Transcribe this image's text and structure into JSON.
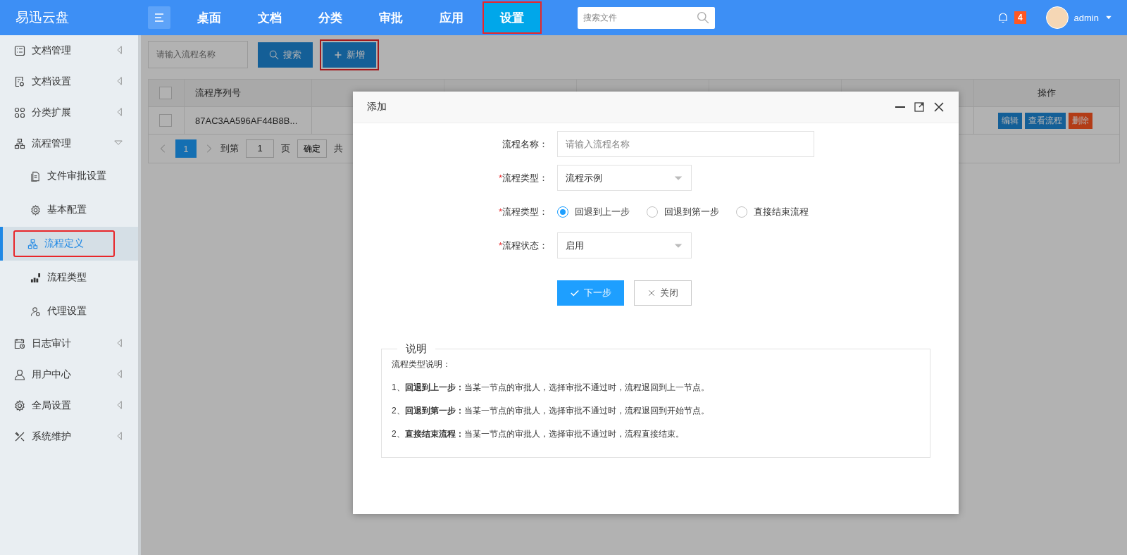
{
  "header": {
    "logo": "易迅云盘",
    "nav": [
      {
        "label": "桌面",
        "selected": false,
        "highlighted": false
      },
      {
        "label": "文档",
        "selected": false,
        "highlighted": false
      },
      {
        "label": "分类",
        "selected": false,
        "highlighted": false
      },
      {
        "label": "审批",
        "selected": false,
        "highlighted": false
      },
      {
        "label": "应用",
        "selected": false,
        "highlighted": false
      },
      {
        "label": "设置",
        "selected": true,
        "highlighted": true
      }
    ],
    "search": {
      "placeholder": "搜索文件"
    },
    "notifications": "4",
    "user": "admin"
  },
  "sidebar": {
    "items": [
      {
        "label": "文档管理",
        "expanded": false
      },
      {
        "label": "文档设置",
        "expanded": false
      },
      {
        "label": "分类扩展",
        "expanded": false
      },
      {
        "label": "流程管理",
        "expanded": true,
        "children": [
          {
            "label": "文件审批设置",
            "selected": false,
            "highlighted": false
          },
          {
            "label": "基本配置",
            "selected": false,
            "highlighted": false
          },
          {
            "label": "流程定义",
            "selected": true,
            "highlighted": true
          },
          {
            "label": "流程类型",
            "selected": false,
            "highlighted": false
          },
          {
            "label": "代理设置",
            "selected": false,
            "highlighted": false
          }
        ]
      },
      {
        "label": "日志审计",
        "expanded": false
      },
      {
        "label": "用户中心",
        "expanded": false
      },
      {
        "label": "全局设置",
        "expanded": false
      },
      {
        "label": "系统维护",
        "expanded": false
      }
    ]
  },
  "toolbar": {
    "search_field": {
      "placeholder": "请输入流程名称"
    },
    "search_button": "搜索",
    "add_button": {
      "label": "新增",
      "highlighted": true
    }
  },
  "table": {
    "select_all": {
      "checked": false
    },
    "columns": [
      "流程序列号",
      "操作"
    ],
    "rows": [
      {
        "checked": false,
        "serial": "87AC3AA596AF44B8B...",
        "actions": [
          {
            "label": "编辑",
            "kind": "edit"
          },
          {
            "label": "查看流程",
            "kind": "view"
          },
          {
            "label": "删除",
            "kind": "delete"
          }
        ]
      }
    ],
    "pagination": {
      "pages": [
        {
          "label": "1",
          "selected": true
        }
      ],
      "goto_label": "到第",
      "goto_value": "1",
      "page_label": "页",
      "confirm": "确定",
      "total": "共"
    }
  },
  "dialog": {
    "title": "添加",
    "required_mark": "*",
    "fields": [
      {
        "kind": "text",
        "label": "流程名称：",
        "required": false,
        "placeholder": "请输入流程名称"
      },
      {
        "kind": "select",
        "label": "流程类型：",
        "required": true,
        "value": "流程示例"
      },
      {
        "kind": "radio",
        "label": "流程类型：",
        "required": true,
        "options": [
          {
            "label": "回退到上一步",
            "selected": true
          },
          {
            "label": "回退到第一步",
            "selected": false
          },
          {
            "label": "直接结束流程",
            "selected": false
          }
        ]
      },
      {
        "kind": "select",
        "label": "流程状态：",
        "required": true,
        "value": "启用"
      }
    ],
    "buttons": [
      {
        "label": "下一步",
        "kind": "primary"
      },
      {
        "label": "关闭",
        "kind": "default"
      }
    ],
    "note": {
      "legend": "说明",
      "lines": [
        "流程类型说明：",
        "1、**回退到上一步：**当某一节点的审批人，选择审批不通过时，流程退回到上一节点。",
        "2、**回退到第一步：**当某一节点的审批人，选择审批不通过时，流程退回到开始节点。",
        "2、**直接结束流程：**当某一节点的审批人，选择审批不通过时，流程直接结束。"
      ]
    }
  }
}
